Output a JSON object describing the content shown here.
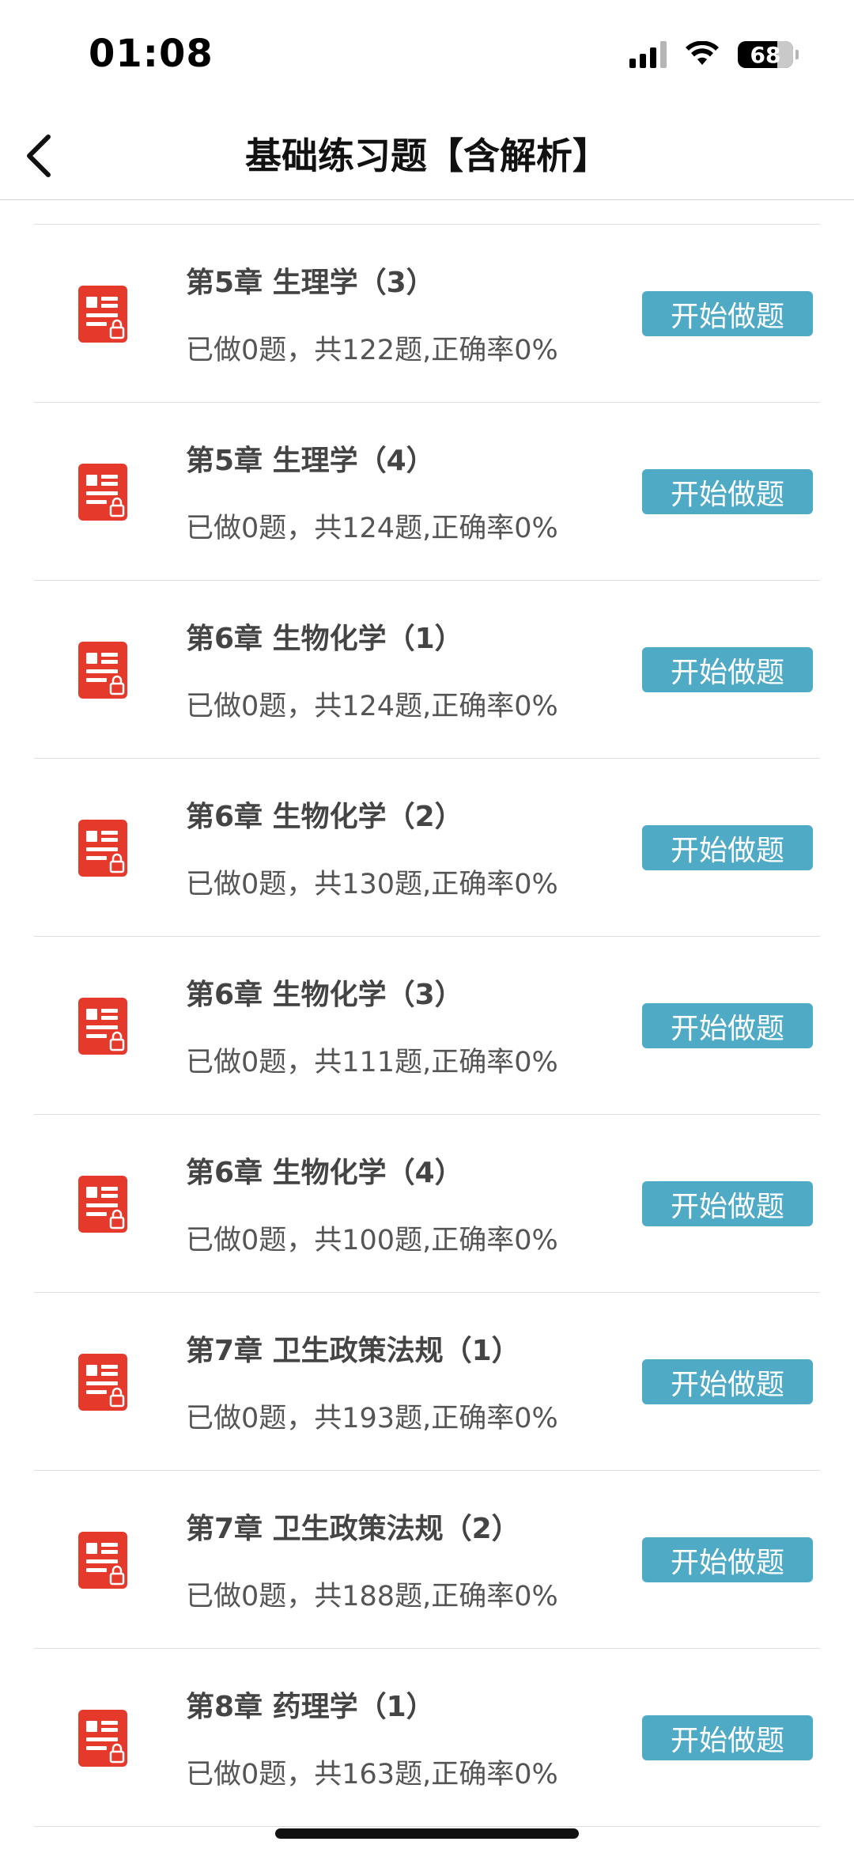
{
  "status_bar": {
    "time": "01:08",
    "battery_level": "68",
    "icons": [
      "signal-icon",
      "wifi-icon",
      "battery-icon"
    ]
  },
  "header": {
    "title": "基础练习题【含解析】",
    "back_icon": "chevron-left-icon"
  },
  "colors": {
    "accent": "#4faac6",
    "icon_red": "#e5392c",
    "text": "#444444"
  },
  "items": [
    {
      "title": "第5章 生理学（3）",
      "progress": "已做0题，共122题,正确率0%",
      "button": "开始做题"
    },
    {
      "title": "第5章 生理学（4）",
      "progress": "已做0题，共124题,正确率0%",
      "button": "开始做题"
    },
    {
      "title": "第6章 生物化学（1）",
      "progress": "已做0题，共124题,正确率0%",
      "button": "开始做题"
    },
    {
      "title": "第6章 生物化学（2）",
      "progress": "已做0题，共130题,正确率0%",
      "button": "开始做题"
    },
    {
      "title": "第6章 生物化学（3）",
      "progress": "已做0题，共111题,正确率0%",
      "button": "开始做题"
    },
    {
      "title": "第6章 生物化学（4）",
      "progress": "已做0题，共100题,正确率0%",
      "button": "开始做题"
    },
    {
      "title": "第7章 卫生政策法规（1）",
      "progress": "已做0题，共193题,正确率0%",
      "button": "开始做题"
    },
    {
      "title": "第7章 卫生政策法规（2）",
      "progress": "已做0题，共188题,正确率0%",
      "button": "开始做题"
    },
    {
      "title": "第8章 药理学（1）",
      "progress": "已做0题，共163题,正确率0%",
      "button": "开始做题"
    }
  ]
}
